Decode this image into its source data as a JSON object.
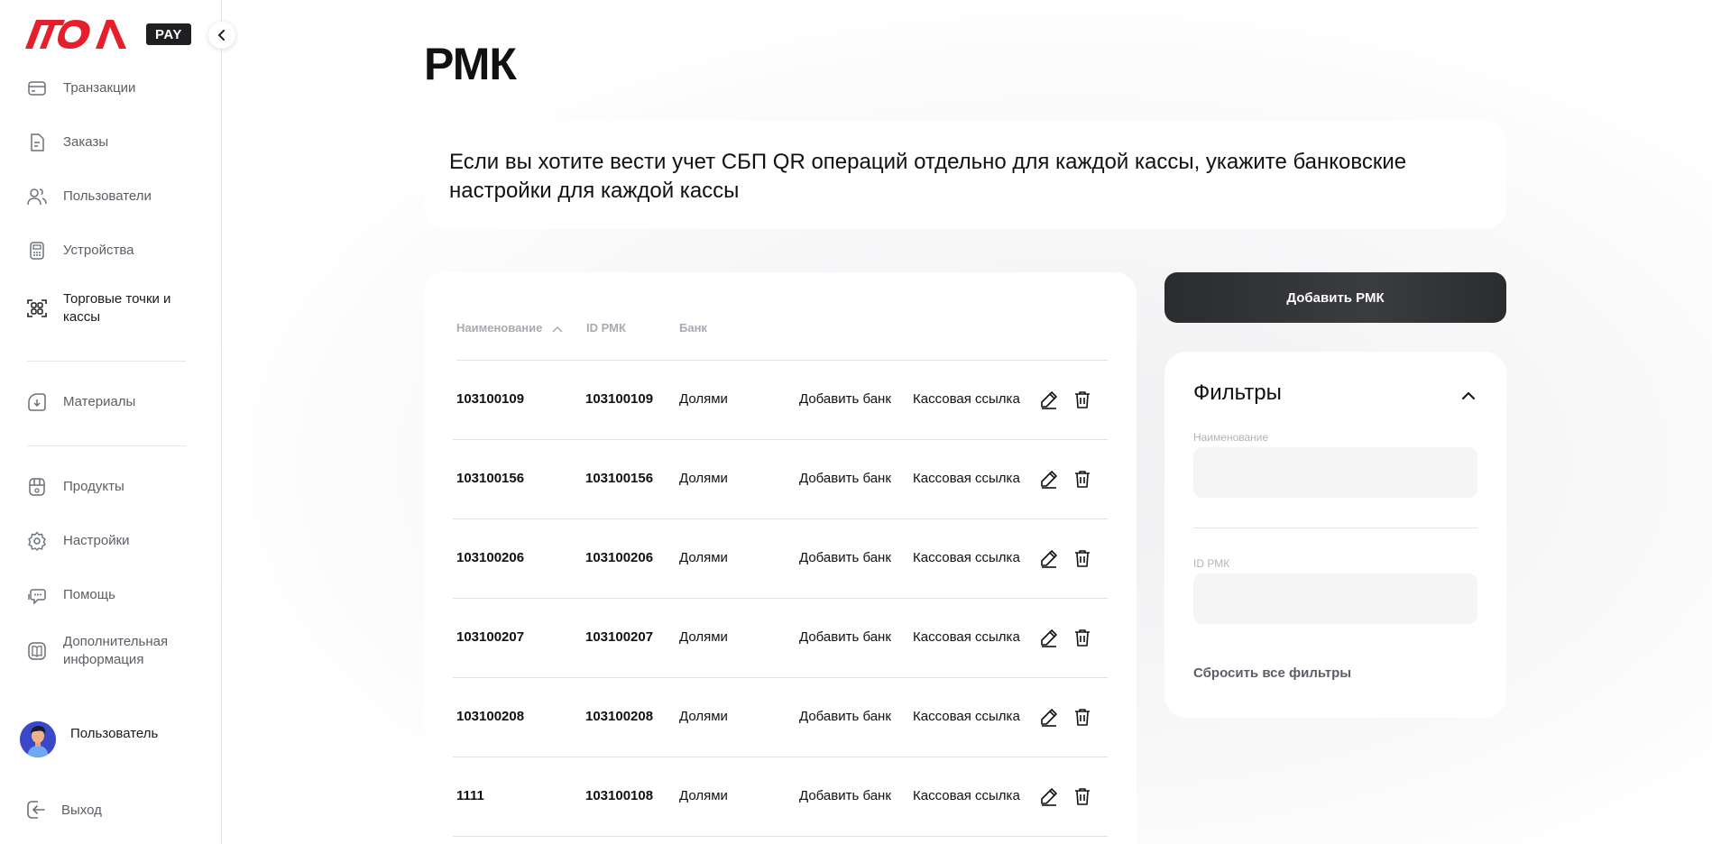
{
  "brand": {
    "logo": "ATOA",
    "badge": "PAY",
    "accent": "#e5202c"
  },
  "sidebar": {
    "items": [
      {
        "label": "Транзакции",
        "icon": "transactions-icon"
      },
      {
        "label": "Заказы",
        "icon": "orders-icon"
      },
      {
        "label": "Пользователи",
        "icon": "users-icon"
      },
      {
        "label": "Устройства",
        "icon": "devices-icon"
      },
      {
        "label": "Торговые точки и кассы",
        "icon": "stores-icon"
      },
      {
        "label": "Материалы",
        "icon": "materials-icon"
      },
      {
        "label": "Продукты",
        "icon": "products-icon"
      },
      {
        "label": "Настройки",
        "icon": "settings-icon"
      },
      {
        "label": "Помощь",
        "icon": "help-icon"
      },
      {
        "label": "Дополнительная информация",
        "icon": "info-book-icon"
      }
    ],
    "user": {
      "name": "Пользователь"
    },
    "logout_label": "Выход"
  },
  "page": {
    "title": "РМК",
    "info": "Если вы хотите вести учет СБП QR операций отдельно для каждой кассы, укажите банковские настройки для каждой кассы"
  },
  "table": {
    "headers": {
      "name": "Наименование",
      "id": "ID РМК",
      "bank": "Банк"
    },
    "rows": [
      {
        "name": "103100109",
        "id": "103100109",
        "bank": "Долями",
        "add_bank": "Добавить банк",
        "cash_link": "Кассовая ссылка"
      },
      {
        "name": "103100156",
        "id": "103100156",
        "bank": "Долями",
        "add_bank": "Добавить банк",
        "cash_link": "Кассовая ссылка"
      },
      {
        "name": "103100206",
        "id": "103100206",
        "bank": "Долями",
        "add_bank": "Добавить банк",
        "cash_link": "Кассовая ссылка"
      },
      {
        "name": "103100207",
        "id": "103100207",
        "bank": "Долями",
        "add_bank": "Добавить банк",
        "cash_link": "Кассовая ссылка"
      },
      {
        "name": "103100208",
        "id": "103100208",
        "bank": "Долями",
        "add_bank": "Добавить банк",
        "cash_link": "Кассовая ссылка"
      },
      {
        "name": "1111",
        "id": "103100108",
        "bank": "Долями",
        "add_bank": "Добавить банк",
        "cash_link": "Кассовая ссылка"
      }
    ]
  },
  "actions": {
    "add_label": "Добавить РМК"
  },
  "filters": {
    "title": "Фильтры",
    "name_label": "Наименование",
    "name_value": "",
    "id_label": "ID РМК",
    "id_value": "",
    "reset_label": "Сбросить все фильтры"
  }
}
